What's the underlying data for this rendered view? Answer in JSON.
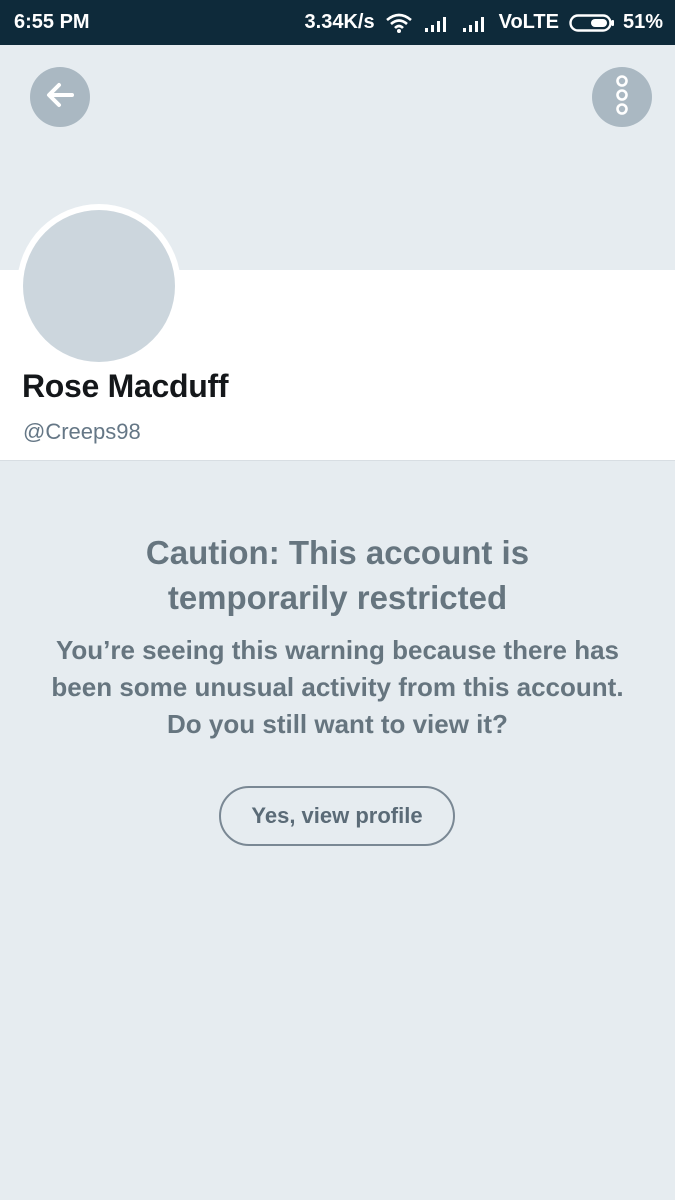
{
  "status_bar": {
    "time": "6:55 PM",
    "network_speed": "3.34K/s",
    "network_type": "VoLTE",
    "battery": "51%",
    "icons": [
      "wifi-icon",
      "signal-icon",
      "signal-icon",
      "battery-icon"
    ]
  },
  "header": {
    "back_icon": "arrow-left-icon",
    "more_icon": "more-vertical-icon"
  },
  "profile": {
    "display_name": "Rose Macduff",
    "handle": "@Creeps98"
  },
  "caution": {
    "title": "Caution: This account is temporarily restricted",
    "message": "You’re seeing this warning because there has been some unusual activity from this account. Do you still want to view it?",
    "button_label": "Yes, view profile"
  },
  "colors": {
    "status_bar_bg": "#0e2a3a",
    "page_bg": "#e6ecf0",
    "round_button_bg": "#aab8c2",
    "avatar_placeholder": "#ccd6dd",
    "caution_text": "#66757f"
  }
}
